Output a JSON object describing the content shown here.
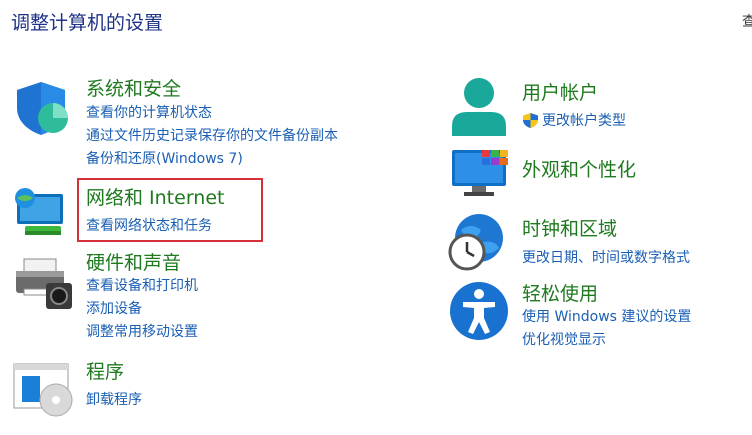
{
  "page_title": "调整计算机的设置",
  "view_by_partial": "查",
  "categories": [
    {
      "title": "系统和安全",
      "links": [
        "查看你的计算机状态",
        "通过文件历史记录保存你的文件备份副本",
        "备份和还原(Windows 7)"
      ]
    },
    {
      "title": "网络和 Internet",
      "links": [
        "查看网络状态和任务"
      ]
    },
    {
      "title": "硬件和声音",
      "links": [
        "查看设备和打印机",
        "添加设备",
        "调整常用移动设置"
      ]
    },
    {
      "title": "程序",
      "links": [
        "卸载程序"
      ]
    },
    {
      "title": "用户帐户",
      "links": [
        "更改帐户类型"
      ]
    },
    {
      "title": "外观和个性化",
      "links": []
    },
    {
      "title": "时钟和区域",
      "links": [
        "更改日期、时间或数字格式"
      ]
    },
    {
      "title": "轻松使用",
      "links": [
        "使用 Windows 建议的设置",
        "优化视觉显示"
      ]
    }
  ],
  "colors": {
    "category_title": "#1f7a1f",
    "link": "#1a5fb4",
    "highlight_border": "#d6303a"
  },
  "icons": [
    "shield-icon",
    "network-icon",
    "printer-icon",
    "programs-icon",
    "user-icon",
    "uac-shield-icon",
    "appearance-icon",
    "clock-globe-icon",
    "accessibility-icon"
  ]
}
